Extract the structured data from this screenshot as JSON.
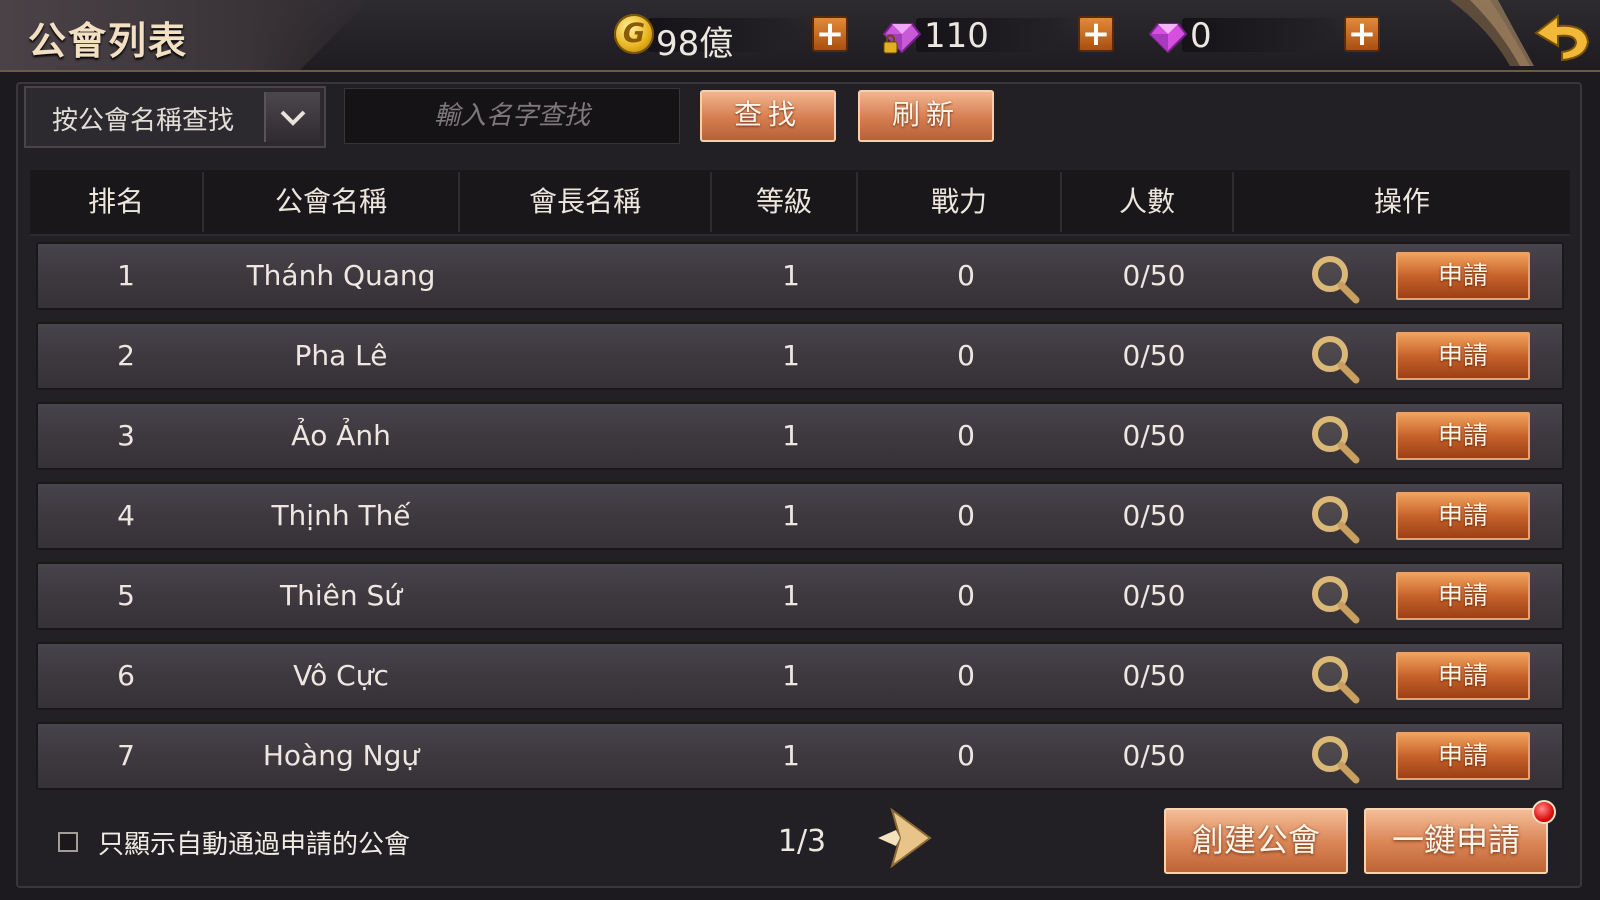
{
  "header": {
    "title": "公會列表",
    "resources": [
      {
        "icon": "gold-coin-icon",
        "value": "98億"
      },
      {
        "icon": "locked-diamond-icon",
        "value": "110"
      },
      {
        "icon": "diamond-icon",
        "value": "0"
      }
    ],
    "add_label": "+"
  },
  "filter": {
    "mode_label": "按公會名稱查找",
    "search_placeholder": "輸入名字查找",
    "search_button": "查找",
    "refresh_button": "刷新"
  },
  "table": {
    "columns": [
      "排名",
      "公會名稱",
      "會長名稱",
      "等級",
      "戰力",
      "人數",
      "操作"
    ],
    "rows": [
      {
        "rank": "1",
        "name": "Thánh Quang",
        "leader": "",
        "level": "1",
        "power": "0",
        "members": "0/50",
        "action": "申請"
      },
      {
        "rank": "2",
        "name": "Pha Lê",
        "leader": "",
        "level": "1",
        "power": "0",
        "members": "0/50",
        "action": "申請"
      },
      {
        "rank": "3",
        "name": "Ảo Ảnh",
        "leader": "",
        "level": "1",
        "power": "0",
        "members": "0/50",
        "action": "申請"
      },
      {
        "rank": "4",
        "name": "Thịnh Thế",
        "leader": "",
        "level": "1",
        "power": "0",
        "members": "0/50",
        "action": "申請"
      },
      {
        "rank": "5",
        "name": "Thiên Sứ",
        "leader": "",
        "level": "1",
        "power": "0",
        "members": "0/50",
        "action": "申請"
      },
      {
        "rank": "6",
        "name": "Vô Cực",
        "leader": "",
        "level": "1",
        "power": "0",
        "members": "0/50",
        "action": "申請"
      },
      {
        "rank": "7",
        "name": "Hoàng Ngự",
        "leader": "",
        "level": "1",
        "power": "0",
        "members": "0/50",
        "action": "申請"
      }
    ]
  },
  "footer": {
    "auto_approve_label": "只顯示自動通過申請的公會",
    "auto_approve_checked": false,
    "page": "1/3",
    "create_button": "創建公會",
    "one_click_apply_button": "一鍵申請"
  },
  "colors": {
    "accent_orange": "#d57d4f",
    "panel_bg": "#222024",
    "notification_red": "#e01010"
  }
}
